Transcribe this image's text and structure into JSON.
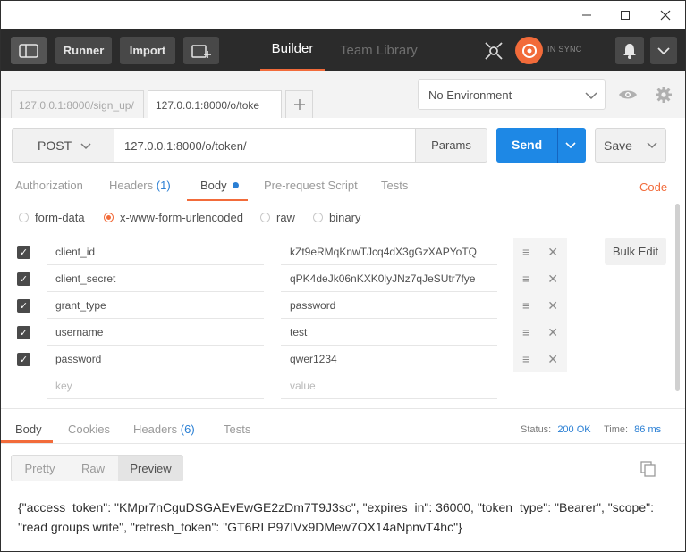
{
  "window": {
    "minimize": "—",
    "maximize": "☐",
    "close": "✕"
  },
  "toolbar": {
    "runner": "Runner",
    "import": "Import",
    "tab_builder": "Builder",
    "tab_team_library": "Team Library",
    "sync_status": "IN SYNC"
  },
  "tabs": [
    {
      "label": "127.0.0.1:8000/sign_up/"
    },
    {
      "label": "127.0.0.1:8000/o/toke"
    }
  ],
  "environment": {
    "selected": "No Environment"
  },
  "request": {
    "method": "POST",
    "url": "127.0.0.1:8000/o/token/",
    "params": "Params",
    "send": "Send",
    "save": "Save"
  },
  "subtabs": {
    "authorization": "Authorization",
    "headers": "Headers",
    "headers_count": "(1)",
    "body": "Body",
    "pre_request": "Pre-request Script",
    "tests": "Tests",
    "code": "Code"
  },
  "body_types": {
    "form_data": "form-data",
    "urlencoded": "x-www-form-urlencoded",
    "raw": "raw",
    "binary": "binary"
  },
  "form": {
    "bulk_edit": "Bulk Edit",
    "rows": [
      {
        "key": "client_id",
        "value": "kZt9eRMqKnwTJcq4dX3gGzXAPYoTQ"
      },
      {
        "key": "client_secret",
        "value": "qPK4deJk06nKXK0lyJNz7qJeSUtr7fye"
      },
      {
        "key": "grant_type",
        "value": "password"
      },
      {
        "key": "username",
        "value": "test"
      },
      {
        "key": "password",
        "value": "qwer1234"
      }
    ],
    "key_placeholder": "key",
    "value_placeholder": "value"
  },
  "response": {
    "tab_body": "Body",
    "tab_cookies": "Cookies",
    "tab_headers": "Headers",
    "tab_headers_count": "(6)",
    "tab_tests": "Tests",
    "status_label": "Status:",
    "status_value": "200 OK",
    "time_label": "Time:",
    "time_value": "86 ms",
    "view_pretty": "Pretty",
    "view_raw": "Raw",
    "view_preview": "Preview",
    "json_text": "{\"access_token\": \"KMpr7nCguDSGAEvEwGE2zDm7T9J3sc\", \"expires_in\": 36000, \"token_type\": \"Bearer\", \"scope\": \"read groups write\", \"refresh_token\": \"GT6RLP97IVx9DMew7OX14aNpnvT4hc\"}"
  },
  "colors": {
    "accent_orange": "#f26b3a",
    "send_blue": "#1e88e5",
    "link_blue": "#2a7fd4",
    "header_dark": "#2b2b2b"
  }
}
